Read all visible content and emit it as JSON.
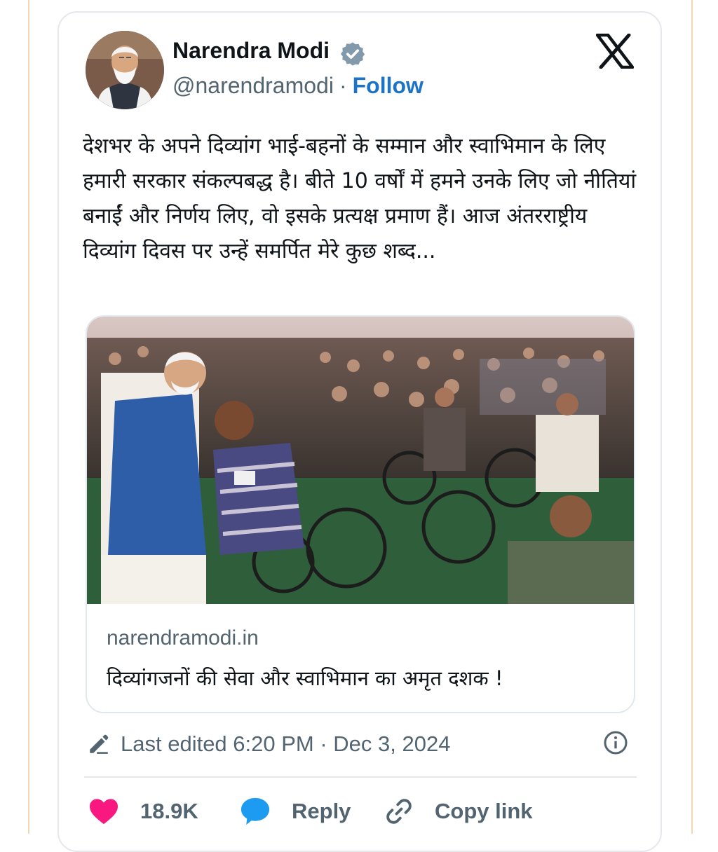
{
  "tweet": {
    "author_name": "Narendra Modi",
    "handle": "@narendramodi",
    "separator": "·",
    "follow_label": "Follow",
    "text": "देशभर के अपने दिव्यांग भाई-बहनों के सम्मान और स्वाभिमान के लिए हमारी सरकार संकल्पबद्ध है। बीते 10 वर्षों में हमने उनके लिए जो नीतियां बनाईं और निर्णय लिए, वो इसके प्रत्यक्ष प्रमाण हैं। आज अंतरराष्ट्रीय दिव्यांग दिवस पर उन्हें समर्पित मेरे कुछ शब्द...",
    "link_card": {
      "domain": "narendramodi.in",
      "title": "दिव्यांगजनों की सेवा और स्वाभिमान का अमृत दशक !"
    },
    "edited_text": "Last edited 6:20 PM · Dec 3, 2024",
    "likes_count": "18.9K",
    "reply_label": "Reply",
    "copy_link_label": "Copy link"
  },
  "icons": [
    "verified-badge-icon",
    "x-logo-icon",
    "edit-pencil-icon",
    "info-icon",
    "heart-icon",
    "reply-bubble-icon",
    "link-icon"
  ],
  "colors": {
    "follow_blue": "#1d74c7",
    "verified_gray": "#829aab",
    "heart_pink": "#f91880",
    "reply_blue": "#1d9bf0",
    "secondary_text": "#536471",
    "primary_text": "#0f1419"
  }
}
